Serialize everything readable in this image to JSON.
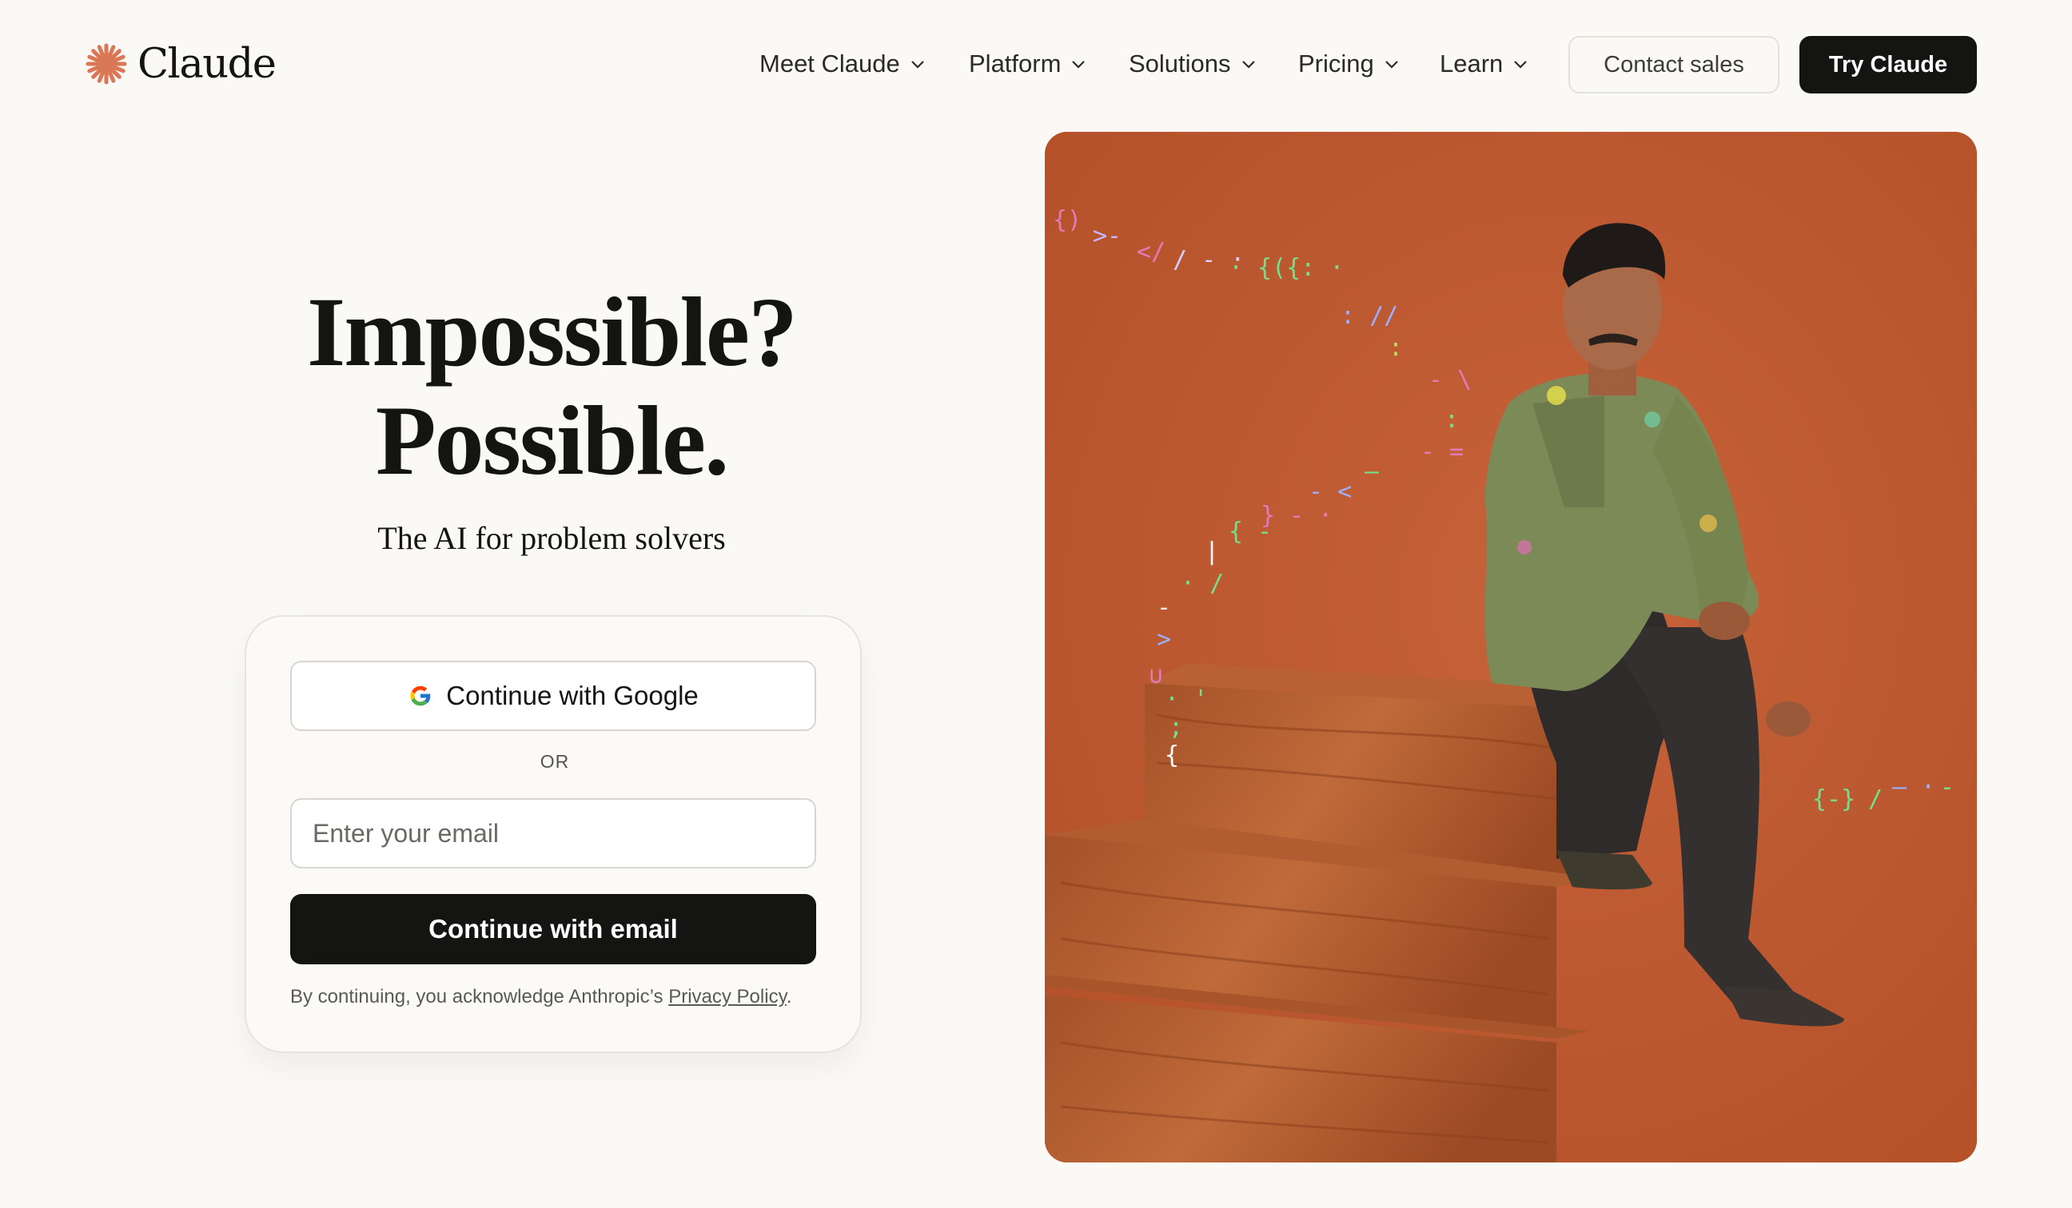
{
  "brand": {
    "name": "Claude",
    "logo_icon": "claude-starburst-icon",
    "accent_color": "#d97757"
  },
  "nav": {
    "items": [
      {
        "label": "Meet Claude",
        "icon": "chevron-down-icon"
      },
      {
        "label": "Platform",
        "icon": "chevron-down-icon"
      },
      {
        "label": "Solutions",
        "icon": "chevron-down-icon"
      },
      {
        "label": "Pricing",
        "icon": "chevron-down-icon"
      },
      {
        "label": "Learn",
        "icon": "chevron-down-icon"
      }
    ],
    "contact_label": "Contact sales",
    "try_label": "Try Claude"
  },
  "hero": {
    "title_line1": "Impossible?",
    "title_line2": "Possible.",
    "subtitle": "The AI for problem solvers"
  },
  "signin": {
    "google_label": "Continue with Google",
    "google_icon": "google-g-icon",
    "or_label": "OR",
    "email_placeholder": "Enter your email",
    "email_value": "",
    "email_button_label": "Continue with email",
    "disclaimer_prefix": "By continuing, you acknowledge Anthropic’s ",
    "privacy_link_label": "Privacy Policy",
    "disclaimer_suffix": "."
  },
  "hero_image": {
    "subject": "person-seated-on-wooden-steps-photo",
    "background_color": "#c0582f"
  }
}
